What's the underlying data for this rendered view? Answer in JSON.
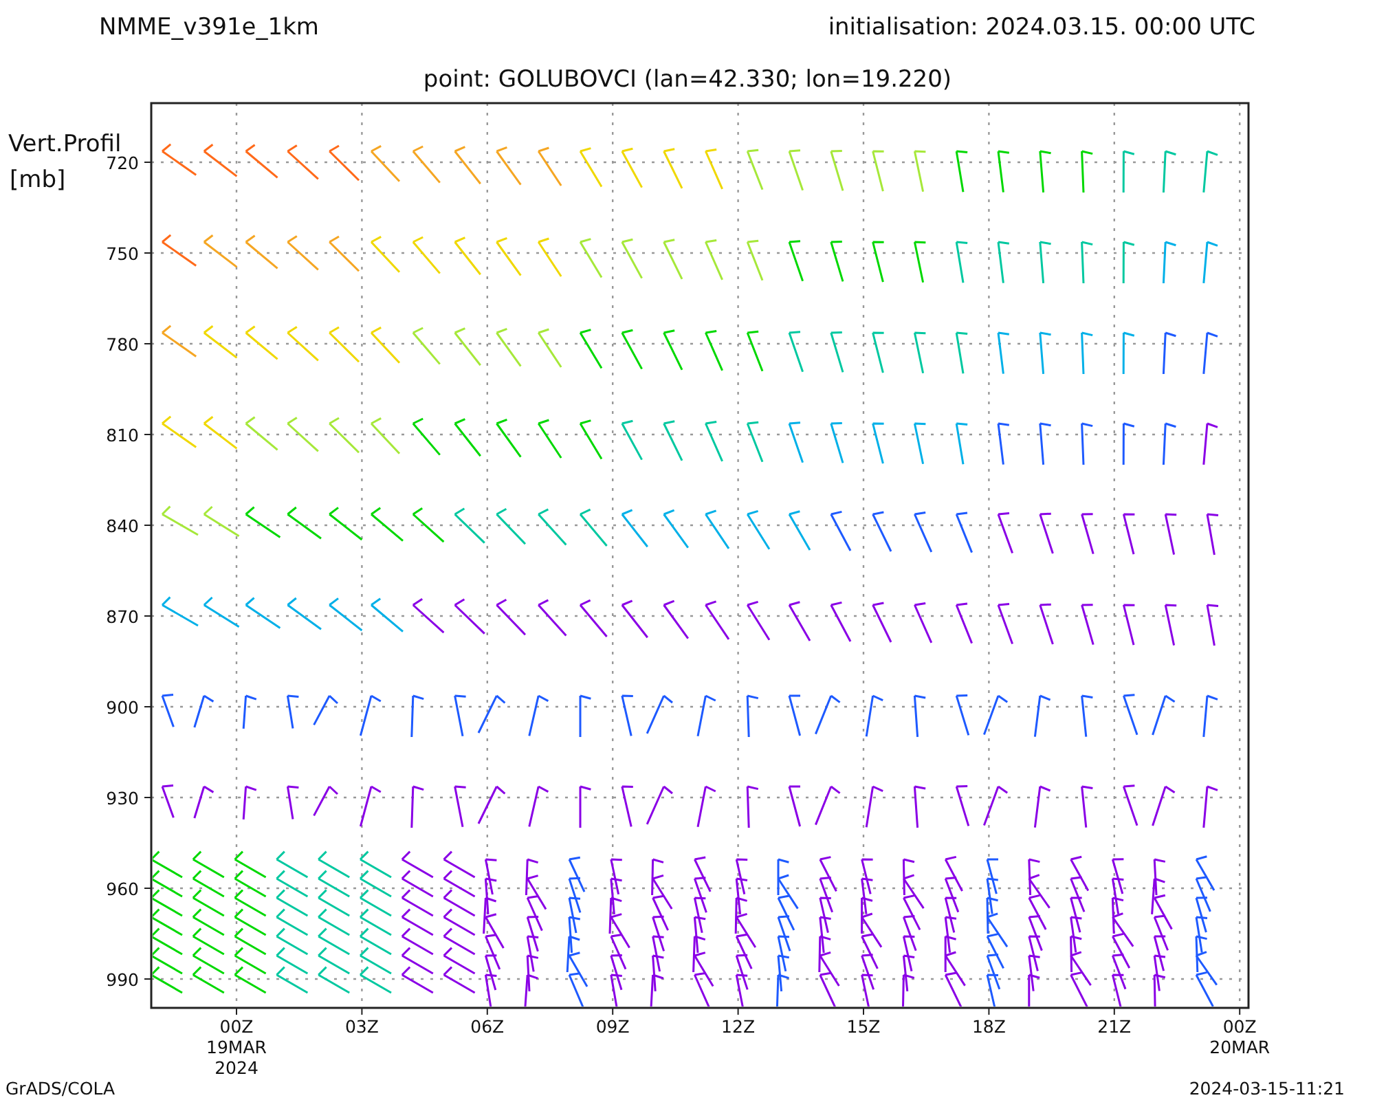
{
  "header": {
    "model": "NMME_v391e_1km",
    "initialisation": "initialisation: 2024.03.15. 00:00 UTC",
    "point": "point: GOLUBOVCI (lan=42.330; lon=19.220)"
  },
  "plot": {
    "y_label": [
      "Vert.Profil",
      "[mb]"
    ],
    "y_ticks": [
      "720",
      "750",
      "780",
      "810",
      "840",
      "870",
      "900",
      "930",
      "960",
      "990"
    ],
    "x_ticks": [
      {
        "lines": [
          "00Z",
          "19MAR",
          "2024"
        ]
      },
      {
        "lines": [
          "03Z"
        ]
      },
      {
        "lines": [
          "06Z"
        ]
      },
      {
        "lines": [
          "09Z"
        ]
      },
      {
        "lines": [
          "12Z"
        ]
      },
      {
        "lines": [
          "15Z"
        ]
      },
      {
        "lines": [
          "18Z"
        ]
      },
      {
        "lines": [
          "21Z"
        ]
      },
      {
        "lines": [
          "00Z",
          "20MAR"
        ]
      }
    ]
  },
  "footer": {
    "left": "GrADS/COLA",
    "right": "2024-03-15-11:21"
  }
}
